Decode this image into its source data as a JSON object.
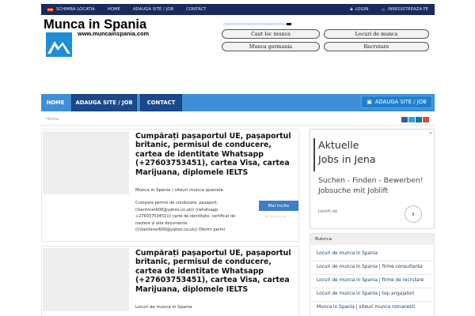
{
  "topbar": {
    "location_label": "SCHIMBA LOCATIA",
    "home_label": "HOME",
    "add_site_label": "ADAUGA SITE / JOB",
    "contact_label": "CONTACT",
    "login_label": "LOGIN",
    "register_label": "INREGISTREAZA-TE"
  },
  "header": {
    "logo_title": "Munca in Spania",
    "logo_url": "www.muncainspania.com",
    "buttons": [
      "Caut loc munca",
      "Locuri de munca",
      "Munca germania",
      "Recrutare"
    ]
  },
  "nav": {
    "home": "HOME",
    "add_site": "ADAUGA SITE / JOB",
    "contact": "CONTACT",
    "cta": "ADAUGA SITE / JOB"
  },
  "breadcrumb": "Home",
  "posts": [
    {
      "title": "Cumpărați pașaportul UE, pașaportul britanic, permisul de conducere, cartea de identitate Whatsapp (+27603753451), cartea Visa, cartea Marijuana, diplomele IELTS",
      "category": "Munca in Spania | siteuri munca spaniole",
      "excerpt_lines": [
        "Cumpara permis de conducere, pașaport,",
        "((kenhiner600@yahoo.co.uk)) ((whatsapp",
        "+27603753451))) carte de identitate, certificat de",
        "naștere și alte documente",
        "((((kenhiner600@yahoo.co.uk)) Oferim permi"
      ],
      "more_label": "Mai multe",
      "stars": "☆☆☆☆☆"
    },
    {
      "title": "Cumpărați pașaportul UE, pașaportul britanic, permisul de conducere, cartea de identitate Whatsapp (+27603753451), cartea Visa, cartea Marijuana, diplomele IELTS",
      "category": "Locuri de munca in Spania"
    }
  ],
  "ad": {
    "headline_1": "Aktuelle",
    "headline_2": "Jobs in Jena",
    "body": "Suchen - Finden - Bewerben! Jobsuche mit Joblift",
    "domain": "joblift.de",
    "close": "✕"
  },
  "rubrica": {
    "heading": "Rubrica",
    "items": [
      "Locuri de munca in Spania",
      "Locuri de munca in Spania | firme consultanta",
      "Locuri de munca in Spania | firme de recrutare",
      "Locuri de munca in Spania | top angajatori",
      "Munca in Spania | siteuri munca romanesti"
    ]
  },
  "colors": {
    "topbar": "#1a2a5c",
    "nav": "#3d8fd8",
    "nav_dark": "#1b4a8c",
    "more_button": "#3d7fc4"
  }
}
